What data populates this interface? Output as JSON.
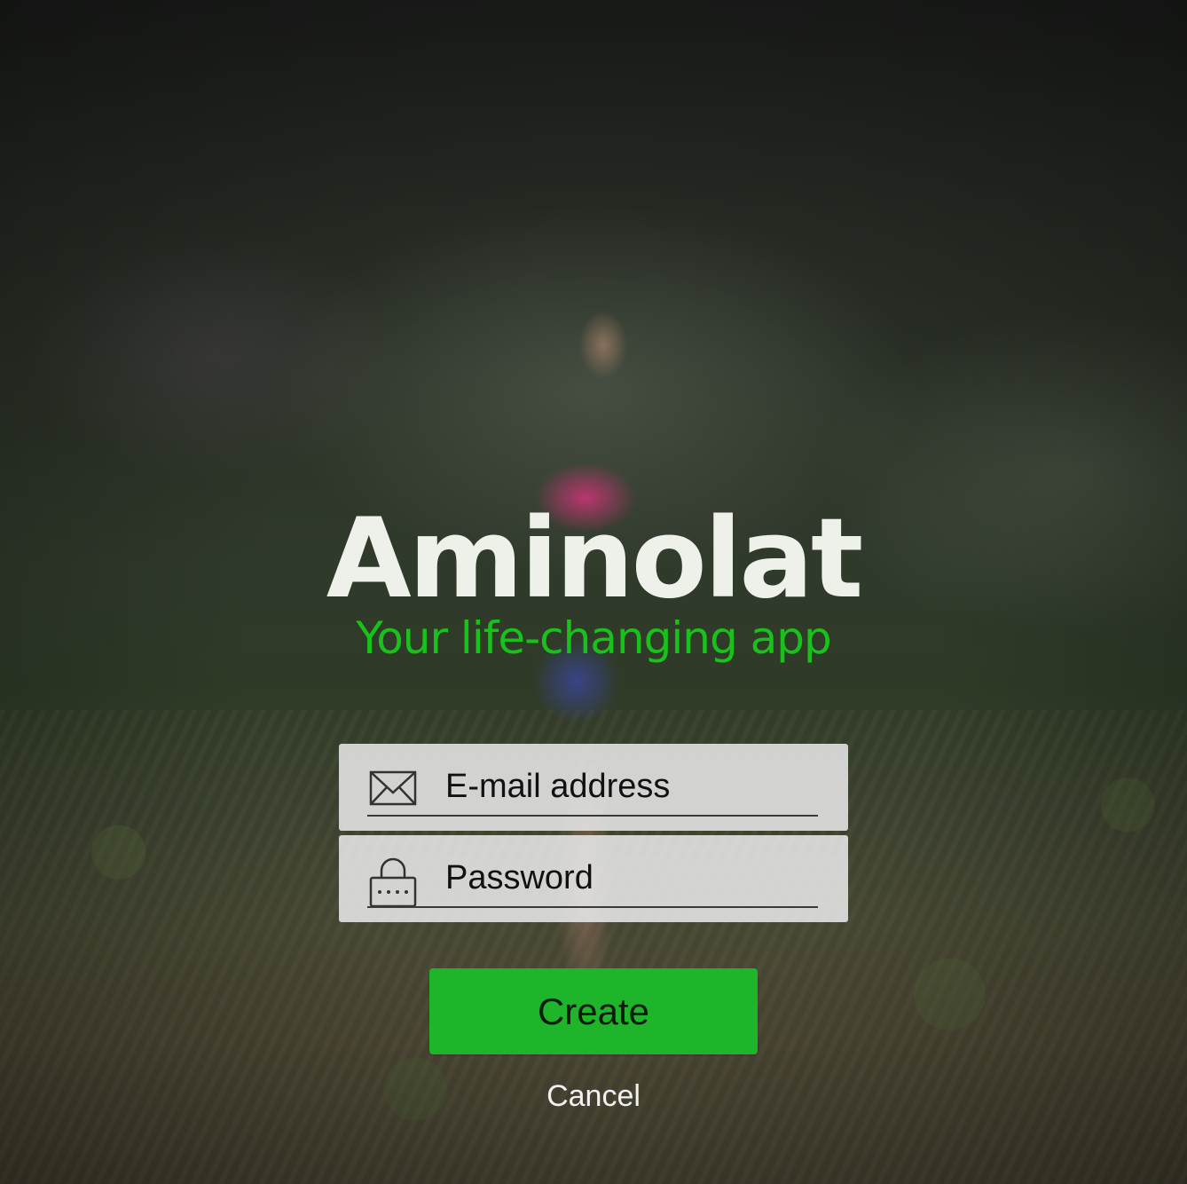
{
  "brand": {
    "logo": "Aminolat",
    "tagline": "Your life-changing app",
    "accent_color": "#1eb52a",
    "logo_color": "#eef0ea"
  },
  "form": {
    "email": {
      "icon": "envelope-icon",
      "placeholder": "E-mail address",
      "value": ""
    },
    "password": {
      "icon": "padlock-icon",
      "placeholder": "Password",
      "value": ""
    },
    "create_label": "Create",
    "cancel_label": "Cancel"
  }
}
